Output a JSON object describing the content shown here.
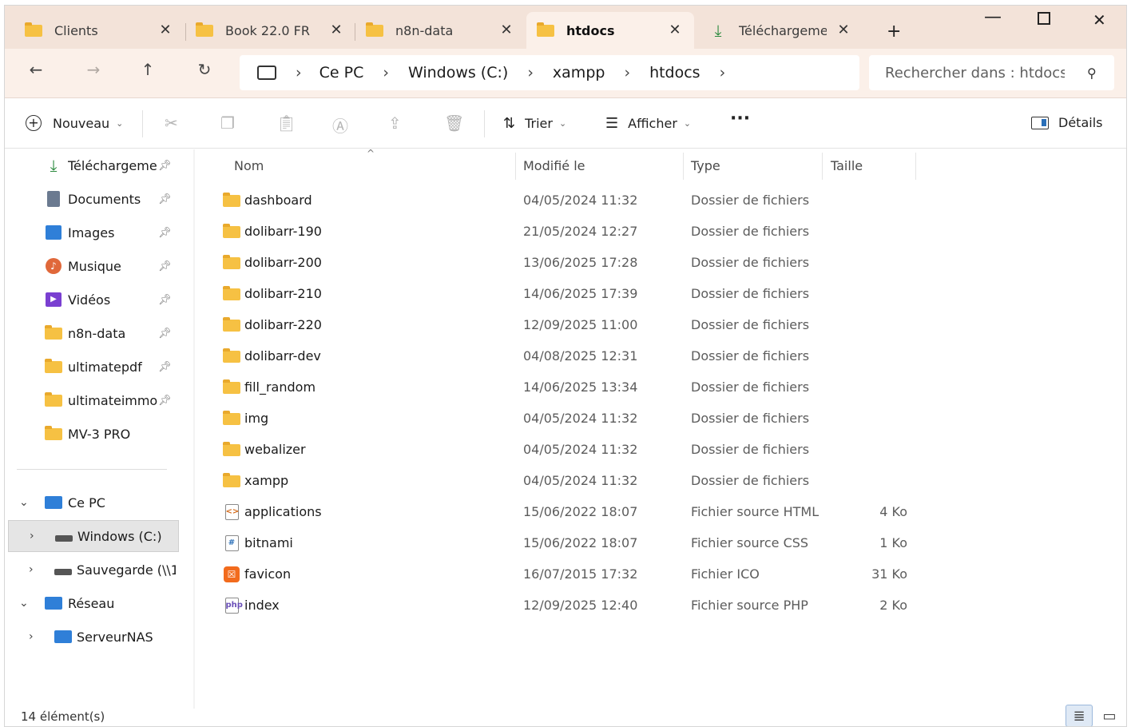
{
  "tabs": [
    {
      "label": "Clients",
      "icon": "folder-icon",
      "active": false
    },
    {
      "label": "Book 22.0 FR",
      "icon": "folder-icon",
      "active": false
    },
    {
      "label": "n8n-data",
      "icon": "folder-icon",
      "active": false
    },
    {
      "label": "htdocs",
      "icon": "folder-icon",
      "active": true
    },
    {
      "label": "Téléchargeme",
      "icon": "download-icon",
      "active": false
    }
  ],
  "breadcrumb": [
    "Ce PC",
    "Windows (C:)",
    "xampp",
    "htdocs"
  ],
  "search": {
    "placeholder": "Rechercher dans : htdocs"
  },
  "toolbar": {
    "new_label": "Nouveau",
    "sort_label": "Trier",
    "view_label": "Afficher",
    "details_label": "Détails"
  },
  "sidebar": {
    "quick": [
      {
        "label": "Téléchargements",
        "icon": "download-icon"
      },
      {
        "label": "Documents",
        "icon": "documents-icon"
      },
      {
        "label": "Images",
        "icon": "images-icon"
      },
      {
        "label": "Musique",
        "icon": "music-icon"
      },
      {
        "label": "Vidéos",
        "icon": "videos-icon"
      },
      {
        "label": "n8n-data",
        "icon": "folder-icon"
      },
      {
        "label": "ultimatepdf",
        "icon": "folder-icon"
      },
      {
        "label": "ultimateimmo",
        "icon": "folder-icon"
      },
      {
        "label": "MV-3 PRO",
        "icon": "folder-icon"
      }
    ],
    "tree": [
      {
        "label": "Ce PC",
        "icon": "pc-icon"
      },
      {
        "label": "Windows (C:)",
        "icon": "drive-icon"
      },
      {
        "label": "Sauvegarde (\\\\1",
        "icon": "network-drive-icon"
      },
      {
        "label": "Réseau",
        "icon": "network-icon"
      },
      {
        "label": "ServeurNAS",
        "icon": "pc-icon"
      }
    ]
  },
  "columns": {
    "name": "Nom",
    "modified": "Modifié le",
    "type": "Type",
    "size": "Taille"
  },
  "files": [
    {
      "name": "dashboard",
      "date": "04/05/2024 11:32",
      "type": "Dossier de fichiers",
      "size": "",
      "icon": "folder-icon"
    },
    {
      "name": "dolibarr-190",
      "date": "21/05/2024 12:27",
      "type": "Dossier de fichiers",
      "size": "",
      "icon": "folder-icon"
    },
    {
      "name": "dolibarr-200",
      "date": "13/06/2025 17:28",
      "type": "Dossier de fichiers",
      "size": "",
      "icon": "folder-icon"
    },
    {
      "name": "dolibarr-210",
      "date": "14/06/2025 17:39",
      "type": "Dossier de fichiers",
      "size": "",
      "icon": "folder-icon"
    },
    {
      "name": "dolibarr-220",
      "date": "12/09/2025 11:00",
      "type": "Dossier de fichiers",
      "size": "",
      "icon": "folder-icon"
    },
    {
      "name": "dolibarr-dev",
      "date": "04/08/2025 12:31",
      "type": "Dossier de fichiers",
      "size": "",
      "icon": "folder-icon"
    },
    {
      "name": "fill_random",
      "date": "14/06/2025 13:34",
      "type": "Dossier de fichiers",
      "size": "",
      "icon": "folder-icon"
    },
    {
      "name": "img",
      "date": "04/05/2024 11:32",
      "type": "Dossier de fichiers",
      "size": "",
      "icon": "folder-icon"
    },
    {
      "name": "webalizer",
      "date": "04/05/2024 11:32",
      "type": "Dossier de fichiers",
      "size": "",
      "icon": "folder-icon"
    },
    {
      "name": "xampp",
      "date": "04/05/2024 11:32",
      "type": "Dossier de fichiers",
      "size": "",
      "icon": "folder-icon"
    },
    {
      "name": "applications",
      "date": "15/06/2022 18:07",
      "type": "Fichier source HTML",
      "size": "4 Ko",
      "icon": "html-file-icon"
    },
    {
      "name": "bitnami",
      "date": "15/06/2022 18:07",
      "type": "Fichier source CSS",
      "size": "1 Ko",
      "icon": "css-file-icon"
    },
    {
      "name": "favicon",
      "date": "16/07/2015 17:32",
      "type": "Fichier ICO",
      "size": "31 Ko",
      "icon": "ico-file-icon"
    },
    {
      "name": "index",
      "date": "12/09/2025 12:40",
      "type": "Fichier source PHP",
      "size": "2 Ko",
      "icon": "php-file-icon"
    }
  ],
  "status": {
    "count": "14 élément(s)"
  }
}
